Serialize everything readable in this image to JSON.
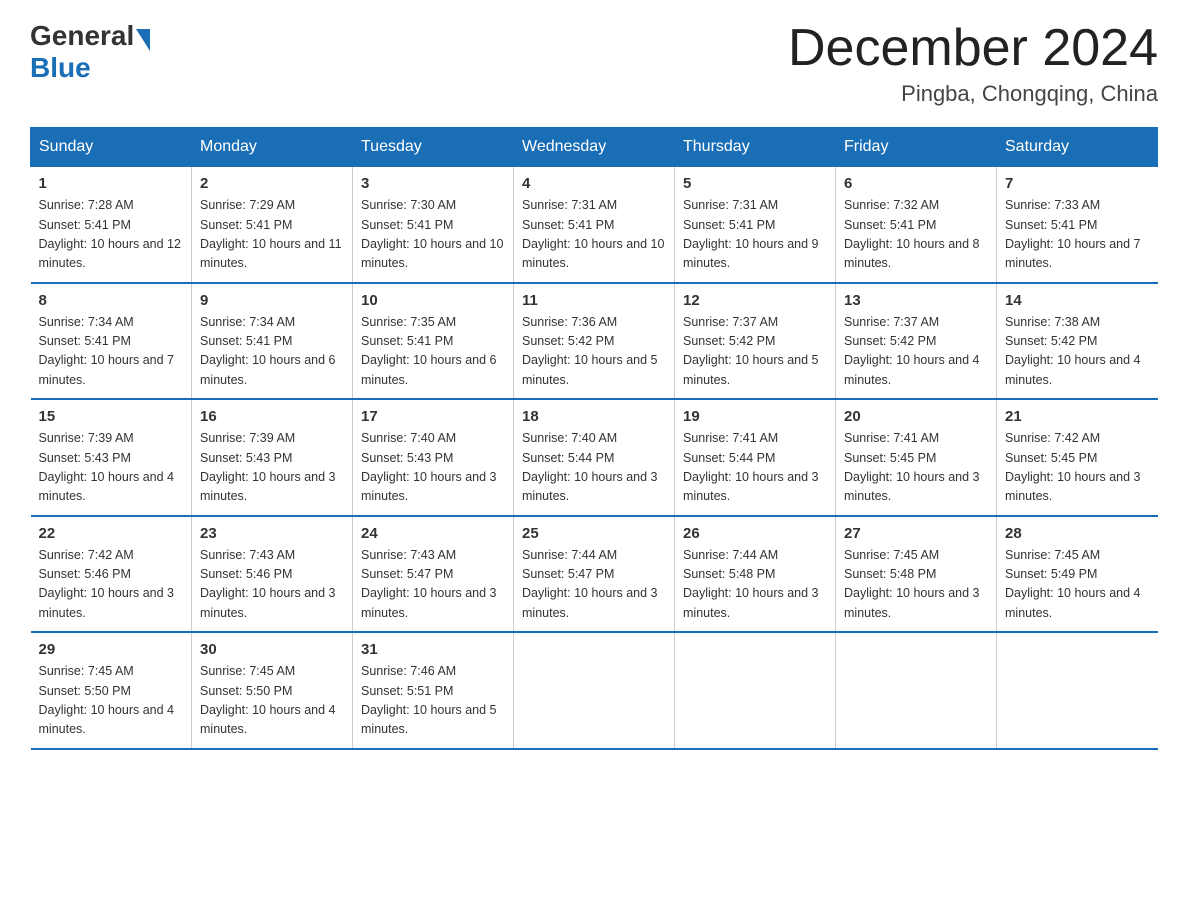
{
  "header": {
    "logo_general": "General",
    "logo_blue": "Blue",
    "month_title": "December 2024",
    "location": "Pingba, Chongqing, China"
  },
  "days_of_week": [
    "Sunday",
    "Monday",
    "Tuesday",
    "Wednesday",
    "Thursday",
    "Friday",
    "Saturday"
  ],
  "weeks": [
    [
      {
        "day": "1",
        "sunrise": "7:28 AM",
        "sunset": "5:41 PM",
        "daylight": "10 hours and 12 minutes."
      },
      {
        "day": "2",
        "sunrise": "7:29 AM",
        "sunset": "5:41 PM",
        "daylight": "10 hours and 11 minutes."
      },
      {
        "day": "3",
        "sunrise": "7:30 AM",
        "sunset": "5:41 PM",
        "daylight": "10 hours and 10 minutes."
      },
      {
        "day": "4",
        "sunrise": "7:31 AM",
        "sunset": "5:41 PM",
        "daylight": "10 hours and 10 minutes."
      },
      {
        "day": "5",
        "sunrise": "7:31 AM",
        "sunset": "5:41 PM",
        "daylight": "10 hours and 9 minutes."
      },
      {
        "day": "6",
        "sunrise": "7:32 AM",
        "sunset": "5:41 PM",
        "daylight": "10 hours and 8 minutes."
      },
      {
        "day": "7",
        "sunrise": "7:33 AM",
        "sunset": "5:41 PM",
        "daylight": "10 hours and 7 minutes."
      }
    ],
    [
      {
        "day": "8",
        "sunrise": "7:34 AM",
        "sunset": "5:41 PM",
        "daylight": "10 hours and 7 minutes."
      },
      {
        "day": "9",
        "sunrise": "7:34 AM",
        "sunset": "5:41 PM",
        "daylight": "10 hours and 6 minutes."
      },
      {
        "day": "10",
        "sunrise": "7:35 AM",
        "sunset": "5:41 PM",
        "daylight": "10 hours and 6 minutes."
      },
      {
        "day": "11",
        "sunrise": "7:36 AM",
        "sunset": "5:42 PM",
        "daylight": "10 hours and 5 minutes."
      },
      {
        "day": "12",
        "sunrise": "7:37 AM",
        "sunset": "5:42 PM",
        "daylight": "10 hours and 5 minutes."
      },
      {
        "day": "13",
        "sunrise": "7:37 AM",
        "sunset": "5:42 PM",
        "daylight": "10 hours and 4 minutes."
      },
      {
        "day": "14",
        "sunrise": "7:38 AM",
        "sunset": "5:42 PM",
        "daylight": "10 hours and 4 minutes."
      }
    ],
    [
      {
        "day": "15",
        "sunrise": "7:39 AM",
        "sunset": "5:43 PM",
        "daylight": "10 hours and 4 minutes."
      },
      {
        "day": "16",
        "sunrise": "7:39 AM",
        "sunset": "5:43 PM",
        "daylight": "10 hours and 3 minutes."
      },
      {
        "day": "17",
        "sunrise": "7:40 AM",
        "sunset": "5:43 PM",
        "daylight": "10 hours and 3 minutes."
      },
      {
        "day": "18",
        "sunrise": "7:40 AM",
        "sunset": "5:44 PM",
        "daylight": "10 hours and 3 minutes."
      },
      {
        "day": "19",
        "sunrise": "7:41 AM",
        "sunset": "5:44 PM",
        "daylight": "10 hours and 3 minutes."
      },
      {
        "day": "20",
        "sunrise": "7:41 AM",
        "sunset": "5:45 PM",
        "daylight": "10 hours and 3 minutes."
      },
      {
        "day": "21",
        "sunrise": "7:42 AM",
        "sunset": "5:45 PM",
        "daylight": "10 hours and 3 minutes."
      }
    ],
    [
      {
        "day": "22",
        "sunrise": "7:42 AM",
        "sunset": "5:46 PM",
        "daylight": "10 hours and 3 minutes."
      },
      {
        "day": "23",
        "sunrise": "7:43 AM",
        "sunset": "5:46 PM",
        "daylight": "10 hours and 3 minutes."
      },
      {
        "day": "24",
        "sunrise": "7:43 AM",
        "sunset": "5:47 PM",
        "daylight": "10 hours and 3 minutes."
      },
      {
        "day": "25",
        "sunrise": "7:44 AM",
        "sunset": "5:47 PM",
        "daylight": "10 hours and 3 minutes."
      },
      {
        "day": "26",
        "sunrise": "7:44 AM",
        "sunset": "5:48 PM",
        "daylight": "10 hours and 3 minutes."
      },
      {
        "day": "27",
        "sunrise": "7:45 AM",
        "sunset": "5:48 PM",
        "daylight": "10 hours and 3 minutes."
      },
      {
        "day": "28",
        "sunrise": "7:45 AM",
        "sunset": "5:49 PM",
        "daylight": "10 hours and 4 minutes."
      }
    ],
    [
      {
        "day": "29",
        "sunrise": "7:45 AM",
        "sunset": "5:50 PM",
        "daylight": "10 hours and 4 minutes."
      },
      {
        "day": "30",
        "sunrise": "7:45 AM",
        "sunset": "5:50 PM",
        "daylight": "10 hours and 4 minutes."
      },
      {
        "day": "31",
        "sunrise": "7:46 AM",
        "sunset": "5:51 PM",
        "daylight": "10 hours and 5 minutes."
      },
      null,
      null,
      null,
      null
    ]
  ],
  "labels": {
    "sunrise_prefix": "Sunrise: ",
    "sunset_prefix": "Sunset: ",
    "daylight_prefix": "Daylight: "
  },
  "colors": {
    "header_bg": "#1a6eb5",
    "logo_blue": "#1a6eb5"
  }
}
